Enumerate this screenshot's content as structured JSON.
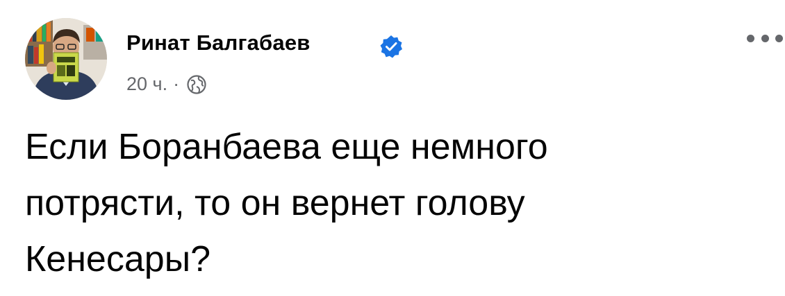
{
  "post": {
    "author": {
      "name": "Ринат Балгабаев",
      "verified": true,
      "verified_icon": "verified-badge-icon",
      "verified_color": "#1b74e4"
    },
    "meta": {
      "time": "20 ч.",
      "separator": "·",
      "audience_icon": "globe-icon"
    },
    "menu_icon": "more-options-icon",
    "text": "Если Боранбаева еще немного\nпотрясти, то он вернет голову\nКенесары?"
  },
  "colors": {
    "text_primary": "#050505",
    "text_secondary": "#65676b",
    "background": "#ffffff"
  }
}
